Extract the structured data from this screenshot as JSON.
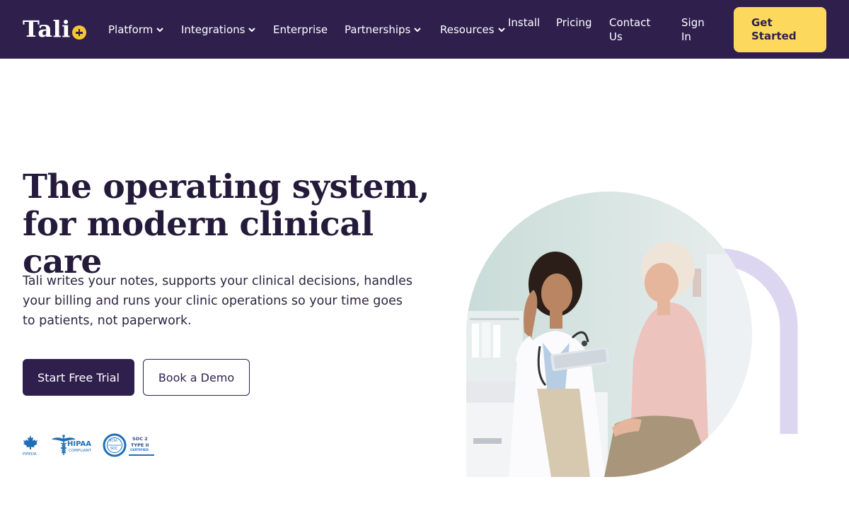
{
  "brand": {
    "logo_text": "Tali"
  },
  "nav": {
    "items": [
      {
        "label": "Platform",
        "has_dropdown": true
      },
      {
        "label": "Integrations",
        "has_dropdown": true
      },
      {
        "label": "Enterprise",
        "has_dropdown": false
      },
      {
        "label": "Partnerships",
        "has_dropdown": true
      },
      {
        "label": "Resources",
        "has_dropdown": true
      },
      {
        "label": "Install",
        "has_dropdown": false
      },
      {
        "label": "Pricing",
        "has_dropdown": false
      },
      {
        "label": "Contact Us",
        "has_dropdown": false
      },
      {
        "label": "Sign In",
        "has_dropdown": false
      }
    ],
    "cta_label": "Get Started"
  },
  "hero": {
    "title_line1": "The operating system,",
    "title_line2": "for modern clinical care",
    "subtitle": "Tali writes your notes, supports your clinical decisions, handles your billing and runs your clinic operations so your time goes to patients, not paperwork.",
    "primary_button": "Start Free Trial",
    "secondary_button": "Book a Demo"
  },
  "compliance": {
    "pipeda": "PIPEDA",
    "hipaa": "HIPAA",
    "hipaa_sub": "COMPLIANT",
    "aicpa": "AICPA",
    "soc": "SOC",
    "soc2_line1": "SOC 2",
    "soc2_line2": "TYPE II",
    "soc2_line3": "CERTIFIED"
  },
  "colors": {
    "nav_bg": "#2e1f4d",
    "accent_yellow": "#fcd95c",
    "arch_lavender": "#ddd6f0",
    "badge_blue": "#1e6fb8"
  },
  "icons": [
    "chevron-down-icon",
    "maple-leaf-icon",
    "caduceus-icon",
    "aicpa-soc-seal-icon"
  ]
}
